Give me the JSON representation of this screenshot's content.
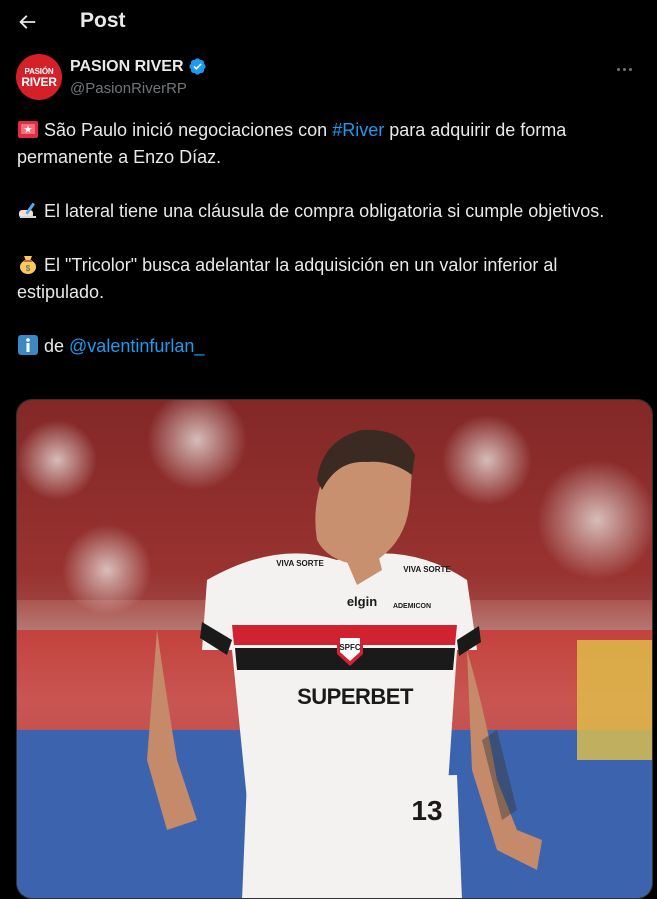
{
  "header": {
    "title": "Post",
    "back_icon": "arrow-left-icon"
  },
  "author": {
    "avatar_text_top": "PASIÓN",
    "avatar_text_bottom": "RIVER",
    "name": "PASION RIVER",
    "handle": "@PasionRiverRP",
    "verified": true,
    "avatar_color": "#d5202a"
  },
  "post": {
    "p1": {
      "emoji": "rotating-light-icon",
      "before": "São Paulo inició negociaciones con ",
      "link": "#River",
      "after": " para adquirir de forma permanente a Enzo Díaz."
    },
    "p2": {
      "emoji": "writing-hand-icon",
      "text": "El lateral tiene una cláusula de compra obligatoria si cumple objetivos."
    },
    "p3": {
      "emoji": "money-bag-icon",
      "text": "El \"Tricolor\" busca adelantar la adquisición en un valor inferior al estipulado."
    },
    "p4": {
      "emoji": "information-icon",
      "prefix": "de ",
      "link": "@valentinfurlan_"
    }
  },
  "media": {
    "jersey_sponsor": "SUPERBET",
    "jersey_crest": "SPFC",
    "jersey_brand": "elgin",
    "sleeve_sponsor": "VIVA SORTE",
    "chest_sponsor_small": "ADEMICON",
    "shorts_number": "13"
  },
  "colors": {
    "background": "#000000",
    "text": "#e7e9ea",
    "muted": "#71767b",
    "link": "#1d9bf0"
  }
}
